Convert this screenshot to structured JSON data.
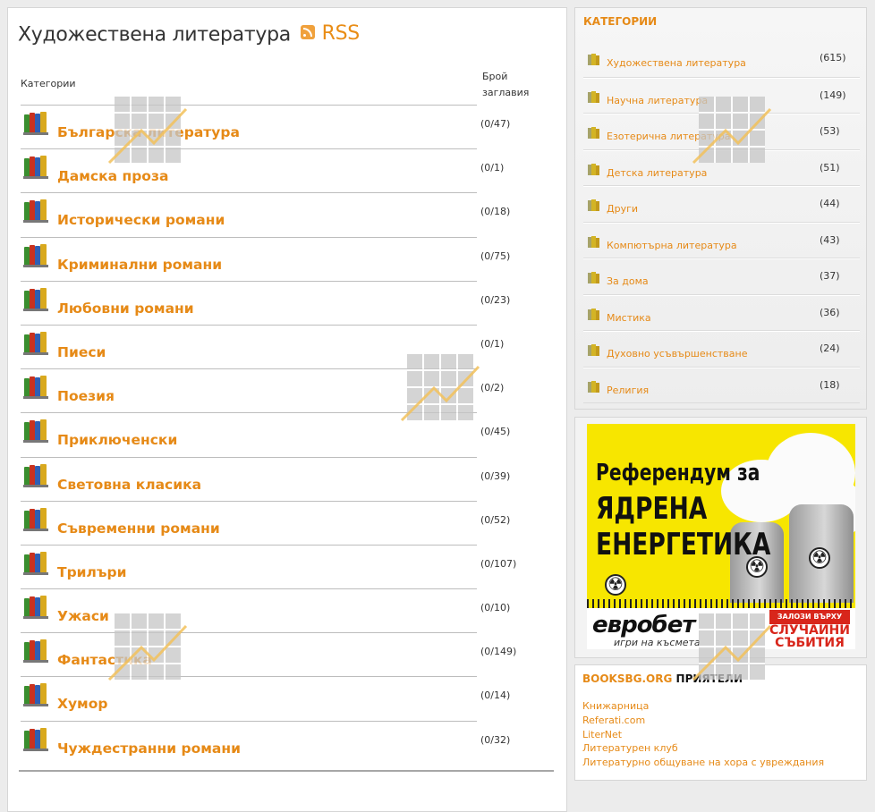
{
  "main": {
    "title": "Художествена литература",
    "rss_label": "RSS",
    "col_category": "Категории",
    "col_count_line1": "Брой",
    "col_count_line2": "заглавия",
    "categories": [
      {
        "name": "Българска литература",
        "count": "(0/47)"
      },
      {
        "name": "Дамска проза",
        "count": "(0/1)"
      },
      {
        "name": "Исторически романи",
        "count": "(0/18)"
      },
      {
        "name": "Криминални романи",
        "count": "(0/75)"
      },
      {
        "name": "Любовни романи",
        "count": "(0/23)"
      },
      {
        "name": "Пиеси",
        "count": "(0/1)"
      },
      {
        "name": "Поезия",
        "count": "(0/2)"
      },
      {
        "name": "Приключенски",
        "count": "(0/45)"
      },
      {
        "name": "Световна класика",
        "count": "(0/39)"
      },
      {
        "name": "Съвременни романи",
        "count": "(0/52)"
      },
      {
        "name": "Трилъри",
        "count": "(0/107)"
      },
      {
        "name": "Ужаси",
        "count": "(0/10)"
      },
      {
        "name": "Фантастика",
        "count": "(0/149)"
      },
      {
        "name": "Хумор",
        "count": "(0/14)"
      },
      {
        "name": "Чуждестранни романи",
        "count": "(0/32)"
      }
    ]
  },
  "sidebar": {
    "categories_title": "КАТЕГОРИИ",
    "categories": [
      {
        "name": "Художествена литература",
        "count": "(615)"
      },
      {
        "name": "Научна литература",
        "count": "(149)"
      },
      {
        "name": "Езотерична литература",
        "count": "(53)"
      },
      {
        "name": "Детска литература",
        "count": "(51)"
      },
      {
        "name": "Други",
        "count": "(44)"
      },
      {
        "name": "Компютърна литература",
        "count": "(43)"
      },
      {
        "name": "За дома",
        "count": "(37)"
      },
      {
        "name": "Мистика",
        "count": "(36)"
      },
      {
        "name": "Духовно усъвършенстване",
        "count": "(24)"
      },
      {
        "name": "Религия",
        "count": "(18)"
      }
    ],
    "ad": {
      "line1": "Референдум за",
      "line2": "ЯДРЕНА",
      "line3": "ЕНЕРГЕТИКА",
      "brand": "евробет",
      "brand_sub": "игри на късмета",
      "brand2_small": "ЗАЛОЗИ ВЪРХУ",
      "brand2_line1": "СЛУЧАЙНИ",
      "brand2_line2": "СЪБИТИЯ"
    },
    "friends_title_orange": "BOOKSBG.ORG",
    "friends_title_dark": "ПРИЯТЕЛИ",
    "friends": [
      "Книжарница",
      "Referati.com",
      "LiterNet",
      "Литературен клуб",
      "Литературно общуване на хора с увреждания"
    ]
  },
  "colors": {
    "accent": "#e68a17",
    "text": "#333333",
    "divider": "#bdbdbd"
  }
}
